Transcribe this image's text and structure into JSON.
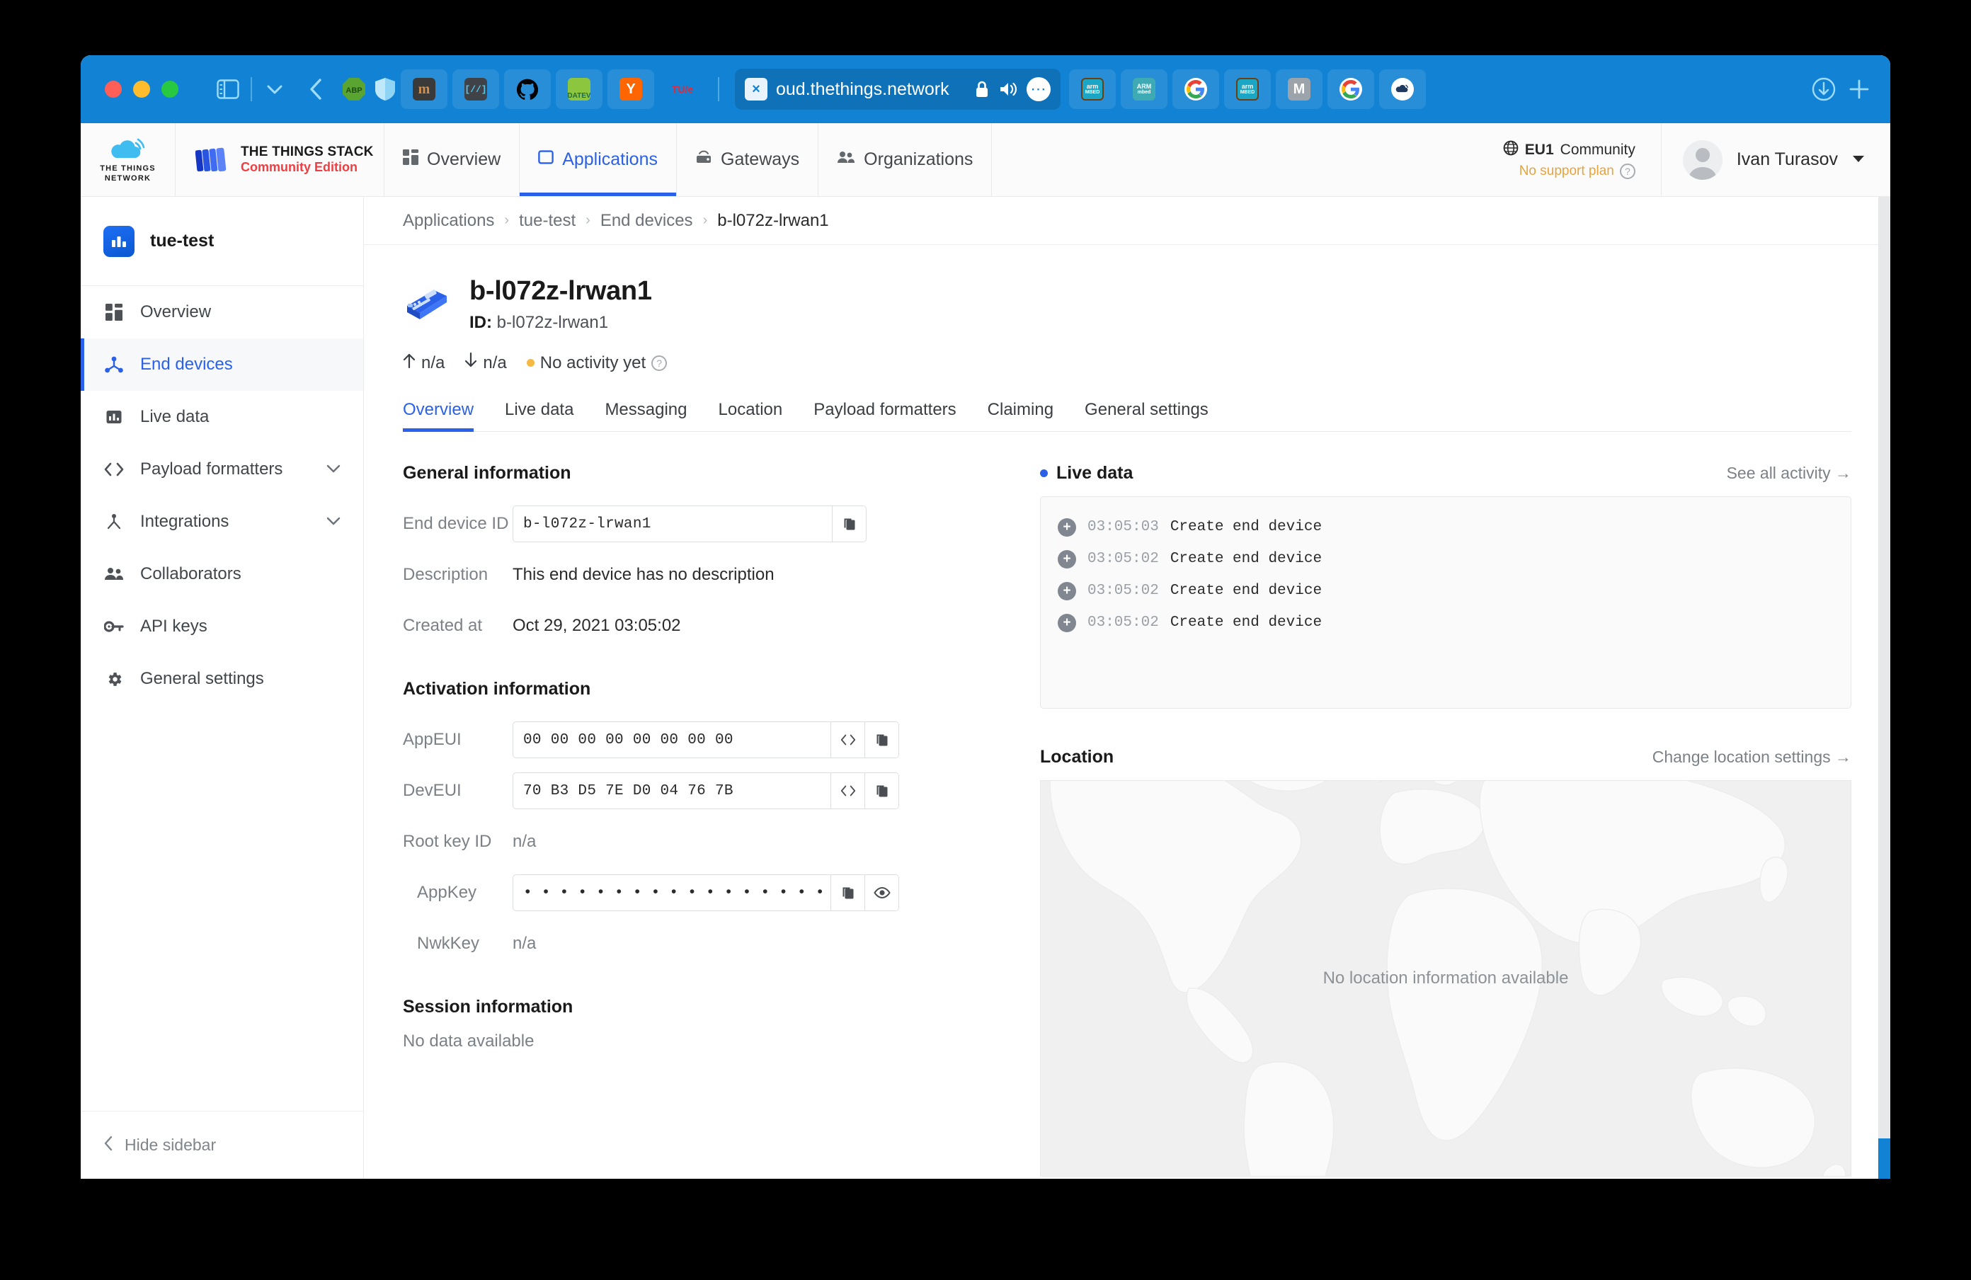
{
  "browser": {
    "traffic_lights": [
      "close",
      "minimize",
      "zoom"
    ],
    "url": {
      "dim_prefix": "",
      "text": "oud.thethings.network",
      "full_visible": "oud.thethings.network"
    },
    "left_icons": [
      "sidebar-toggle-icon",
      "chevron-down-icon",
      "back-icon"
    ],
    "extensions": [
      {
        "name": "adblock-plus-icon",
        "label": "ABP"
      },
      {
        "name": "shield-icon",
        "label": ""
      }
    ],
    "tabs": [
      {
        "name": "tab-mendeley",
        "label": "m"
      },
      {
        "name": "tab-code",
        "label": "[//]"
      },
      {
        "name": "tab-github",
        "label": ""
      },
      {
        "name": "tab-datev",
        "label": "DATEV"
      },
      {
        "name": "tab-hackernews",
        "label": "Y"
      },
      {
        "name": "tab-tue",
        "label": "TU/e"
      },
      {
        "name": "tab-active-ttn",
        "label": ""
      },
      {
        "name": "tab-arm-mbed-1",
        "label": "arm MBED"
      },
      {
        "name": "tab-arm-mbed-2",
        "label": "ARM mbed"
      },
      {
        "name": "tab-google-1",
        "label": "G"
      },
      {
        "name": "tab-arm-mbed-3",
        "label": "arm MBED"
      },
      {
        "name": "tab-mbed-m",
        "label": "M"
      },
      {
        "name": "tab-google-2",
        "label": "G"
      },
      {
        "name": "tab-ttn-cloud",
        "label": ""
      }
    ],
    "right_buttons": [
      {
        "name": "downloads-icon",
        "label": ""
      },
      {
        "name": "new-tab-icon",
        "label": "+"
      }
    ]
  },
  "header": {
    "ttn_logo_line1": "THE THINGS",
    "ttn_logo_line2": "NETWORK",
    "stack_title": "THE THINGS STACK",
    "stack_subtitle": "Community Edition",
    "nav": [
      {
        "label": "Overview",
        "icon": "grid-icon",
        "active": false
      },
      {
        "label": "Applications",
        "icon": "application-icon",
        "active": true
      },
      {
        "label": "Gateways",
        "icon": "gateway-icon",
        "active": false
      },
      {
        "label": "Organizations",
        "icon": "organizations-icon",
        "active": false
      }
    ],
    "cluster": {
      "name": "EU1",
      "type": "Community",
      "icon": "globe-icon"
    },
    "support": {
      "text": "No support plan",
      "help_icon": "question-icon"
    },
    "user": {
      "name": "Ivan Turasov",
      "caret": "chevron-down-icon",
      "avatar": "avatar"
    }
  },
  "sidebar": {
    "entity_name": "tue-test",
    "entity_icon": "application-icon",
    "items": [
      {
        "label": "Overview",
        "icon": "grid-icon",
        "active": false,
        "expandable": false
      },
      {
        "label": "End devices",
        "icon": "end-devices-icon",
        "active": true,
        "expandable": false
      },
      {
        "label": "Live data",
        "icon": "live-data-icon",
        "active": false,
        "expandable": false
      },
      {
        "label": "Payload formatters",
        "icon": "code-icon",
        "active": false,
        "expandable": true
      },
      {
        "label": "Integrations",
        "icon": "integrations-icon",
        "active": false,
        "expandable": true
      },
      {
        "label": "Collaborators",
        "icon": "collaborators-icon",
        "active": false,
        "expandable": false
      },
      {
        "label": "API keys",
        "icon": "key-icon",
        "active": false,
        "expandable": false
      },
      {
        "label": "General settings",
        "icon": "gear-icon",
        "active": false,
        "expandable": false
      }
    ],
    "hide_sidebar_label": "Hide sidebar",
    "hide_sidebar_icon": "chevron-left-icon"
  },
  "breadcrumb": [
    {
      "label": "Applications",
      "current": false
    },
    {
      "label": "tue-test",
      "current": false
    },
    {
      "label": "End devices",
      "current": false
    },
    {
      "label": "b-l072z-lrwan1",
      "current": true
    }
  ],
  "device": {
    "title": "b-l072z-lrwan1",
    "id_label": "ID:",
    "id_value": "b-l072z-lrwan1",
    "uplink": "n/a",
    "downlink": "n/a",
    "activity_status": "No activity yet",
    "icon": "end-device-board-icon"
  },
  "device_tabs": [
    {
      "label": "Overview",
      "active": true
    },
    {
      "label": "Live data",
      "active": false
    },
    {
      "label": "Messaging",
      "active": false
    },
    {
      "label": "Location",
      "active": false
    },
    {
      "label": "Payload formatters",
      "active": false
    },
    {
      "label": "Claiming",
      "active": false
    },
    {
      "label": "General settings",
      "active": false
    }
  ],
  "general_information": {
    "title": "General information",
    "end_device_id_label": "End device ID",
    "end_device_id_value": "b-l072z-lrwan1",
    "description_label": "Description",
    "description_value": "This end device has no description",
    "created_at_label": "Created at",
    "created_at_value": "Oct 29, 2021 03:05:02"
  },
  "activation_information": {
    "title": "Activation information",
    "appeui_label": "AppEUI",
    "appeui_value": "00 00 00 00 00 00 00 00",
    "deveui_label": "DevEUI",
    "deveui_value": "70 B3 D5 7E D0 04 76 7B",
    "root_key_id_label": "Root key ID",
    "root_key_id_value": "n/a",
    "appkey_label": "AppKey",
    "appkey_value": "• • • • • • • • • • • • • • • • • • • • • • • • • • • • • • •",
    "nwkkey_label": "NwkKey",
    "nwkkey_value": "n/a"
  },
  "session_information": {
    "title": "Session information",
    "empty": "No data available"
  },
  "live_data": {
    "title": "Live data",
    "link": "See all activity →",
    "rows": [
      {
        "time": "03:05:03",
        "event": "Create end device",
        "badge": "+"
      },
      {
        "time": "03:05:02",
        "event": "Create end device",
        "badge": "+"
      },
      {
        "time": "03:05:02",
        "event": "Create end device",
        "badge": "+"
      },
      {
        "time": "03:05:02",
        "event": "Create end device",
        "badge": "+"
      }
    ]
  },
  "location": {
    "title": "Location",
    "link": "Change location settings →",
    "empty": "No location information available"
  },
  "colors": {
    "browser_chrome": "#1283d4",
    "accent_blue": "#2b61e8",
    "brand_red": "#ef3e42",
    "warning_amber": "#e8a33d",
    "status_dot": "#f5b944"
  }
}
